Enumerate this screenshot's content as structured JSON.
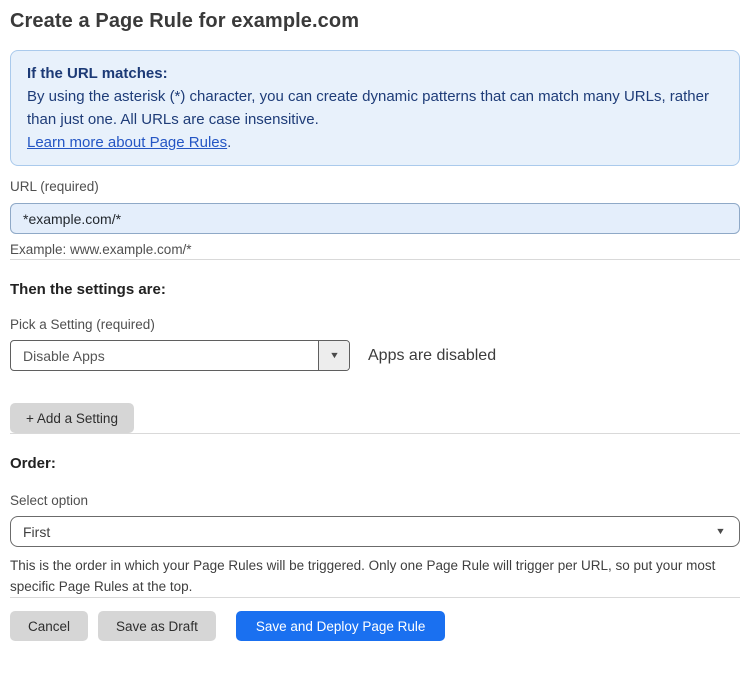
{
  "page": {
    "title": "Create a Page Rule for example.com"
  },
  "info_box": {
    "heading": "If the URL matches:",
    "body": "By using the asterisk (*) character, you can create dynamic patterns that can match many URLs, rather than just one. All URLs are case insensitive.",
    "link_label": "Learn more about Page Rules",
    "link_suffix": "."
  },
  "url_field": {
    "label": "URL (required)",
    "value": "*example.com/*",
    "helper": "Example: www.example.com/*"
  },
  "settings_section": {
    "heading": "Then the settings are:",
    "picker_label": "Pick a Setting (required)",
    "picker_value": "Disable Apps",
    "picker_status": "Apps are disabled",
    "add_setting_label": "+ Add a Setting"
  },
  "order_section": {
    "heading": "Order:",
    "select_label": "Select option",
    "select_value": "First",
    "helper": "This is the order in which your Page Rules will be triggered. Only one Page Rule will trigger per URL, so put your most specific Page Rules at the top."
  },
  "actions": {
    "cancel": "Cancel",
    "save_draft": "Save as Draft",
    "save_deploy": "Save and Deploy Page Rule"
  },
  "icons": {
    "caret_down": "▼"
  },
  "colors": {
    "primary_blue": "#1a70f0",
    "info_box_bg": "#e8f1fb",
    "info_box_border": "#aacaec",
    "info_text": "#1e3c78",
    "link_blue": "#2456c4",
    "url_input_bg": "#e4eefb",
    "button_gray": "#d6d6d6"
  }
}
